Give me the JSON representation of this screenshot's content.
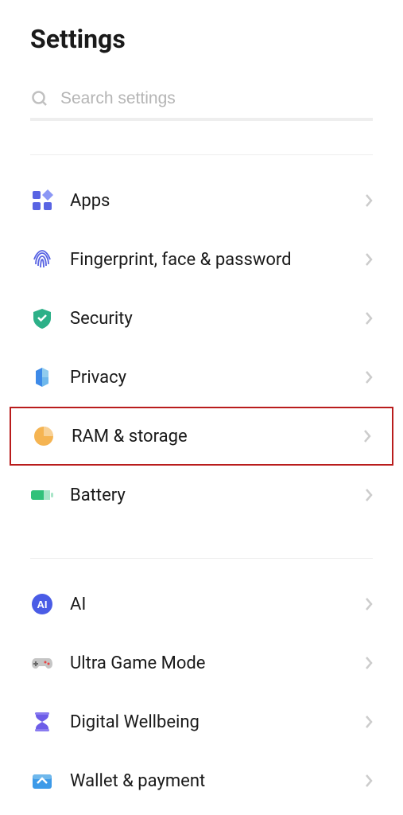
{
  "page_title": "Settings",
  "search": {
    "placeholder": "Search settings"
  },
  "sections": [
    {
      "items": [
        {
          "id": "apps",
          "label": "Apps",
          "icon": "apps-icon"
        },
        {
          "id": "fingerprint",
          "label": "Fingerprint, face & password",
          "icon": "fingerprint-icon"
        },
        {
          "id": "security",
          "label": "Security",
          "icon": "shield-icon"
        },
        {
          "id": "privacy",
          "label": "Privacy",
          "icon": "privacy-icon"
        },
        {
          "id": "ram-storage",
          "label": "RAM & storage",
          "icon": "storage-icon",
          "highlighted": true
        },
        {
          "id": "battery",
          "label": "Battery",
          "icon": "battery-icon"
        }
      ]
    },
    {
      "items": [
        {
          "id": "ai",
          "label": "AI",
          "icon": "ai-icon"
        },
        {
          "id": "ultra-game-mode",
          "label": "Ultra Game Mode",
          "icon": "gamepad-icon"
        },
        {
          "id": "digital-wellbeing",
          "label": "Digital Wellbeing",
          "icon": "hourglass-icon"
        },
        {
          "id": "wallet-payment",
          "label": "Wallet & payment",
          "icon": "wallet-icon"
        }
      ]
    }
  ]
}
